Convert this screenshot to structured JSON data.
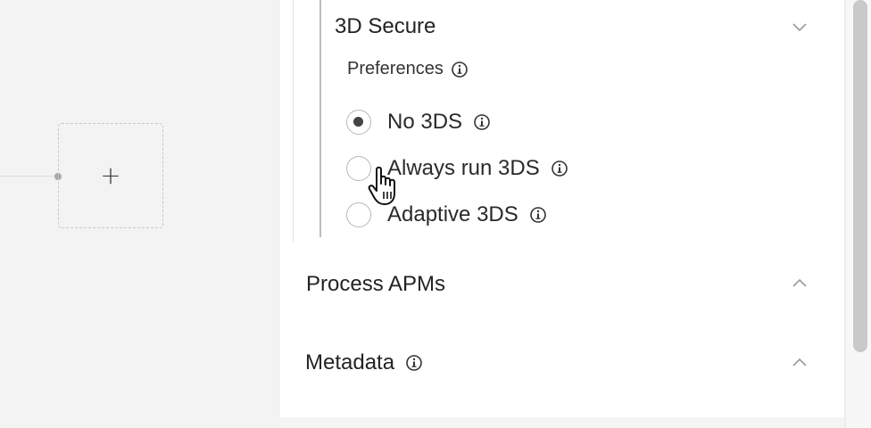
{
  "canvas": {
    "add_node_symbol": "+"
  },
  "three_d_secure": {
    "title": "3D Secure",
    "expanded": true,
    "preferences_label": "Preferences",
    "options": [
      {
        "label": "No 3DS",
        "selected": true
      },
      {
        "label": "Always run 3DS",
        "selected": false
      },
      {
        "label": "Adaptive 3DS",
        "selected": false
      }
    ]
  },
  "process_apms": {
    "title": "Process APMs",
    "expanded": false
  },
  "metadata": {
    "title": "Metadata",
    "expanded": false
  },
  "icons": {
    "info": "info-icon",
    "chevron_down": "chevron-down-icon",
    "chevron_up": "chevron-up-icon",
    "cursor": "hand-pointer-cursor-icon"
  }
}
